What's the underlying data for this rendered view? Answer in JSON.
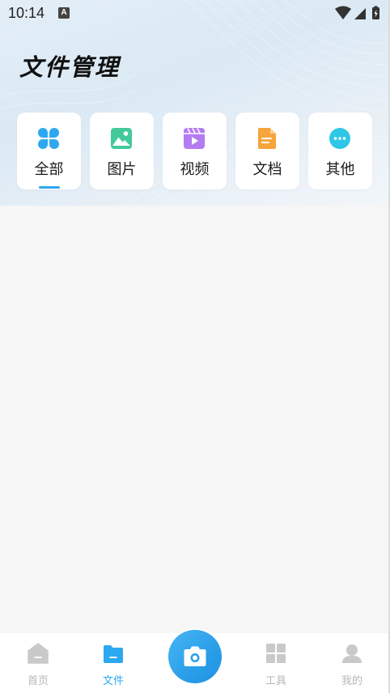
{
  "status_bar": {
    "time": "10:14",
    "notification_letter": "A"
  },
  "header": {
    "title": "文件管理"
  },
  "tabs": [
    {
      "label": "全部",
      "icon": "grid-four-icon",
      "color": "#2da8f0",
      "selected": true
    },
    {
      "label": "图片",
      "icon": "image-icon",
      "color": "#43c99a",
      "selected": false
    },
    {
      "label": "视频",
      "icon": "video-icon",
      "color": "#b47cf3",
      "selected": false
    },
    {
      "label": "文档",
      "icon": "document-icon",
      "color": "#f6a53c",
      "selected": false
    },
    {
      "label": "其他",
      "icon": "more-icon",
      "color": "#2ec7e6",
      "selected": false
    }
  ],
  "bottom_nav": {
    "items": [
      {
        "label": "首页",
        "icon": "home-icon",
        "active": false
      },
      {
        "label": "文件",
        "icon": "folder-icon",
        "active": true
      },
      {
        "label": "工具",
        "icon": "tools-grid-icon",
        "active": false
      },
      {
        "label": "我的",
        "icon": "profile-icon",
        "active": false
      }
    ],
    "center_button": {
      "icon": "camera-icon"
    }
  },
  "colors": {
    "accent": "#2da8f0",
    "inactive": "#b7b7b7"
  }
}
